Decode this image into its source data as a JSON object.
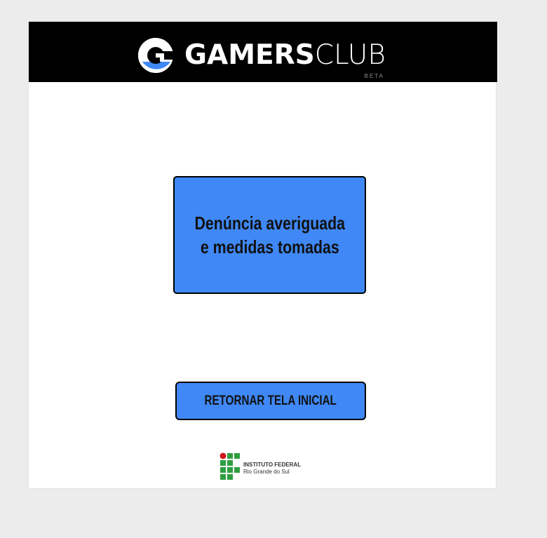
{
  "header": {
    "logo_icon": "gamersclub-g-icon",
    "brand_bold": "GAMERS",
    "brand_light": "CLUB",
    "brand_tag": "BETA"
  },
  "main": {
    "notice_line1": "Denúncia averiguada",
    "notice_line2": "e medidas tomadas",
    "return_button_label": "RETORNAR TELA INICIAL"
  },
  "footer": {
    "institution_icon": "instituto-federal-icon",
    "institution_name": "INSTITUTO FEDERAL",
    "institution_campus": "Rio Grande do Sul"
  },
  "colors": {
    "header_bg": "#000000",
    "accent_blue": "#3f88f6",
    "page_bg": "#ececec",
    "if_green": "#2f9e41",
    "if_red": "#cd191e"
  }
}
